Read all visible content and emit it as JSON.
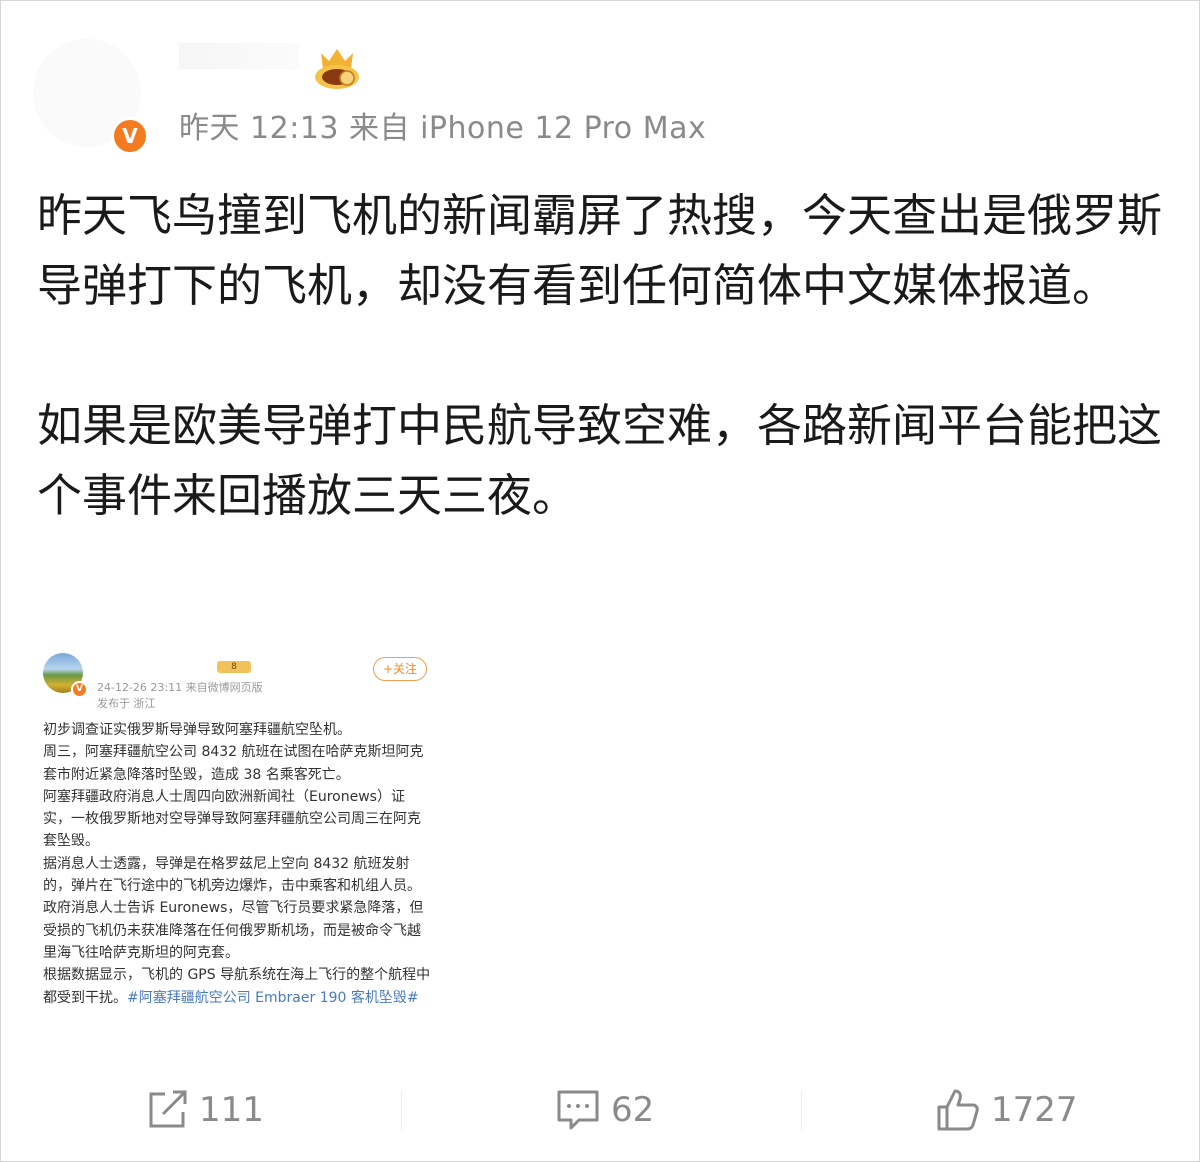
{
  "post": {
    "meta": "昨天 12:13 来自 iPhone 12 Pro Max",
    "verified_mark": "V",
    "paragraphs": [
      "昨天飞鸟撞到飞机的新闻霸屏了热搜，今天查出是俄罗斯导弹打下的飞机，却没有看到任何简体中文媒体报道。",
      "如果是欧美导弹打中民航导致空难，各路新闻平台能把这个事件来回播放三天三夜。"
    ]
  },
  "embedded": {
    "badge": "8",
    "follow_label": "+关注",
    "time": "24-12-26 23:11  来自微博网页版",
    "location": "发布于 浙江",
    "lines": [
      "初步调查证实俄罗斯导弹导致阿塞拜疆航空坠机。",
      "周三，阿塞拜疆航空公司 8432 航班在试图在哈萨克斯坦阿克套市附近紧急降落时坠毁，造成 38 名乘客死亡。",
      "阿塞拜疆政府消息人士周四向欧洲新闻社（Euronews）证实，一枚俄罗斯地对空导弹导致阿塞拜疆航空公司周三在阿克套坠毁。",
      "据消息人士透露，导弹是在格罗兹尼上空向 8432 航班发射的，弹片在飞行途中的飞机旁边爆炸，击中乘客和机组人员。",
      "政府消息人士告诉 Euronews，尽管飞行员要求紧急降落，但受损的飞机仍未获准降落在任何俄罗斯机场，而是被命令飞越里海飞往哈萨克斯坦的阿克套。"
    ],
    "last_line": "根据数据显示，飞机的 GPS 导航系统在海上飞行的整个航程中都受到干扰。",
    "hashtag": "#阿塞拜疆航空公司 Embraer 190 客机坠毁#"
  },
  "actions": {
    "repost_count": "111",
    "comment_count": "62",
    "like_count": "1727"
  },
  "colors": {
    "accent": "#f47b20",
    "meta_text": "#8a8a8a",
    "link": "#4a7bbf"
  }
}
